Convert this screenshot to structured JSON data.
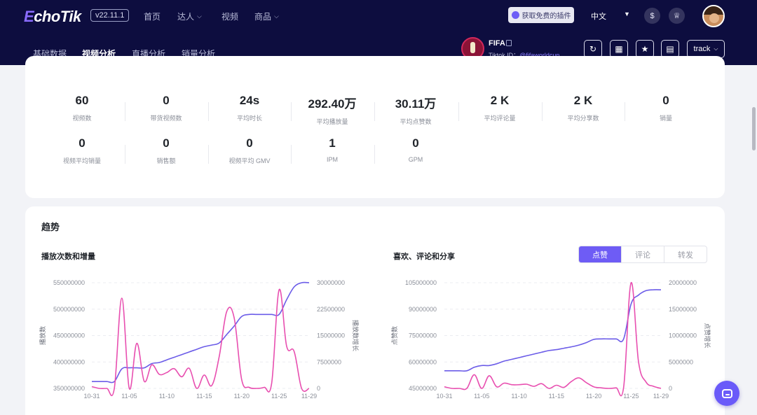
{
  "header": {
    "logo_text": "choTik",
    "logo_mark": "E",
    "version": "v22.11.1",
    "nav": [
      {
        "label": "首页",
        "has_menu": false
      },
      {
        "label": "达人",
        "has_menu": true
      },
      {
        "label": "视频",
        "has_menu": false
      },
      {
        "label": "商品",
        "has_menu": true
      }
    ],
    "plugin_button": "获取免费的插件",
    "language": "中文",
    "icons": [
      "currency-icon",
      "crown-icon"
    ]
  },
  "tabs": [
    {
      "label": "基础数据",
      "active": false
    },
    {
      "label": "视频分析",
      "active": true
    },
    {
      "label": "直播分析",
      "active": false
    },
    {
      "label": "销量分析",
      "active": false
    }
  ],
  "account": {
    "name": "FIFA",
    "id_prefix": "Tiktok ID：",
    "id": "@fifaworldcup",
    "track_label": "track"
  },
  "stats": [
    {
      "value": "60",
      "label": "视频数"
    },
    {
      "value": "0",
      "label": "带货视频数"
    },
    {
      "value": "24s",
      "label": "平均时长"
    },
    {
      "value": "292.40万",
      "label": "平均播放量"
    },
    {
      "value": "30.11万",
      "label": "平均点赞数"
    },
    {
      "value": "2 K",
      "label": "平均评论量"
    },
    {
      "value": "2 K",
      "label": "平均分享数"
    },
    {
      "value": "0",
      "label": "销量"
    },
    {
      "value": "0",
      "label": "视频平均销量"
    },
    {
      "value": "0",
      "label": "销售额"
    },
    {
      "value": "0",
      "label": "视频平均 GMV"
    },
    {
      "value": "1",
      "label": "IPM"
    },
    {
      "value": "0",
      "label": "GPM"
    }
  ],
  "trend": {
    "title": "趋势",
    "left_chart_title": "播放次数和增量",
    "right_chart_title": "喜欢、评论和分享",
    "segments": [
      {
        "label": "点赞",
        "active": true
      },
      {
        "label": "评论",
        "active": false
      },
      {
        "label": "转发",
        "active": false
      }
    ]
  },
  "colors": {
    "primary": "#6e5cf5",
    "total_line": "#6b5ce8",
    "increment_line": "#e84fb0",
    "header_bg": "#0d0d3f"
  },
  "chart_data": [
    {
      "type": "line",
      "title": "播放次数和增量",
      "xlabel": "",
      "ylabel": "播放数",
      "y2label": "播放数增长",
      "x_ticks": [
        "10-31",
        "11-05",
        "11-10",
        "11-15",
        "11-20",
        "11-25",
        "11-29"
      ],
      "y_ticks": [
        "350000000",
        "400000000",
        "450000000",
        "500000000",
        "550000000"
      ],
      "y2_ticks": [
        "0",
        "7500000",
        "15000000",
        "22500000",
        "30000000"
      ],
      "ylim": [
        350000000,
        550000000
      ],
      "y2lim": [
        0,
        30000000
      ],
      "x": [
        "10-31",
        "11-01",
        "11-02",
        "11-03",
        "11-04",
        "11-05",
        "11-06",
        "11-07",
        "11-08",
        "11-09",
        "11-10",
        "11-11",
        "11-12",
        "11-13",
        "11-14",
        "11-15",
        "11-16",
        "11-17",
        "11-18",
        "11-19",
        "11-20",
        "11-21",
        "11-22",
        "11-23",
        "11-24",
        "11-25",
        "11-26",
        "11-27",
        "11-28",
        "11-29"
      ],
      "series": [
        {
          "axis": "left",
          "values": [
            363000000,
            363000000,
            363000000,
            363000000,
            387000000,
            389000000,
            389000000,
            389000000,
            397000000,
            399000000,
            404000000,
            409000000,
            414000000,
            419000000,
            424000000,
            429000000,
            432000000,
            436000000,
            452000000,
            468000000,
            486000000,
            490000000,
            490000000,
            490000000,
            490000000,
            490000000,
            518000000,
            542000000,
            550000000,
            550000000
          ]
        },
        {
          "axis": "right",
          "values": [
            500000,
            0,
            0,
            0,
            25600000,
            0,
            12800000,
            2000000,
            6700000,
            4000000,
            4500000,
            5600000,
            3300000,
            5700000,
            0,
            3800000,
            800000,
            9000000,
            21800000,
            20000000,
            2500000,
            300000,
            0,
            300000,
            1500000,
            28000000,
            12000000,
            10500000,
            0,
            0
          ]
        }
      ]
    },
    {
      "type": "line",
      "title": "喜欢、评论和分享",
      "xlabel": "",
      "ylabel": "点赞数",
      "y2label": "点赞增长",
      "x_ticks": [
        "10-31",
        "11-05",
        "11-10",
        "11-15",
        "11-20",
        "11-25",
        "11-29"
      ],
      "y_ticks": [
        "45000000",
        "60000000",
        "75000000",
        "90000000",
        "105000000"
      ],
      "y2_ticks": [
        "0",
        "5000000",
        "10000000",
        "15000000",
        "20000000"
      ],
      "ylim": [
        45000000,
        105000000
      ],
      "y2lim": [
        0,
        20000000
      ],
      "x": [
        "10-31",
        "11-01",
        "11-02",
        "11-03",
        "11-04",
        "11-05",
        "11-06",
        "11-07",
        "11-08",
        "11-09",
        "11-10",
        "11-11",
        "11-12",
        "11-13",
        "11-14",
        "11-15",
        "11-16",
        "11-17",
        "11-18",
        "11-19",
        "11-20",
        "11-21",
        "11-22",
        "11-23",
        "11-24",
        "11-25",
        "11-26",
        "11-27",
        "11-28",
        "11-29"
      ],
      "series": [
        {
          "axis": "left",
          "values": [
            55000000,
            55000000,
            55000000,
            55000000,
            57000000,
            58000000,
            58000000,
            59000000,
            60500000,
            61500000,
            62500000,
            63500000,
            64500000,
            65500000,
            66500000,
            67000000,
            67800000,
            68600000,
            69600000,
            71000000,
            72800000,
            73100000,
            73100000,
            73100000,
            73100000,
            93000000,
            98000000,
            100500000,
            101000000,
            101000000
          ]
        },
        {
          "axis": "right",
          "values": [
            300000,
            0,
            0,
            0,
            2600000,
            0,
            2400000,
            300000,
            1000000,
            700000,
            700000,
            800000,
            400000,
            900000,
            0,
            600000,
            200000,
            1300000,
            2000000,
            1100000,
            300000,
            100000,
            0,
            100000,
            200000,
            20000000,
            5000000,
            1200000,
            400000,
            0
          ]
        }
      ]
    }
  ]
}
